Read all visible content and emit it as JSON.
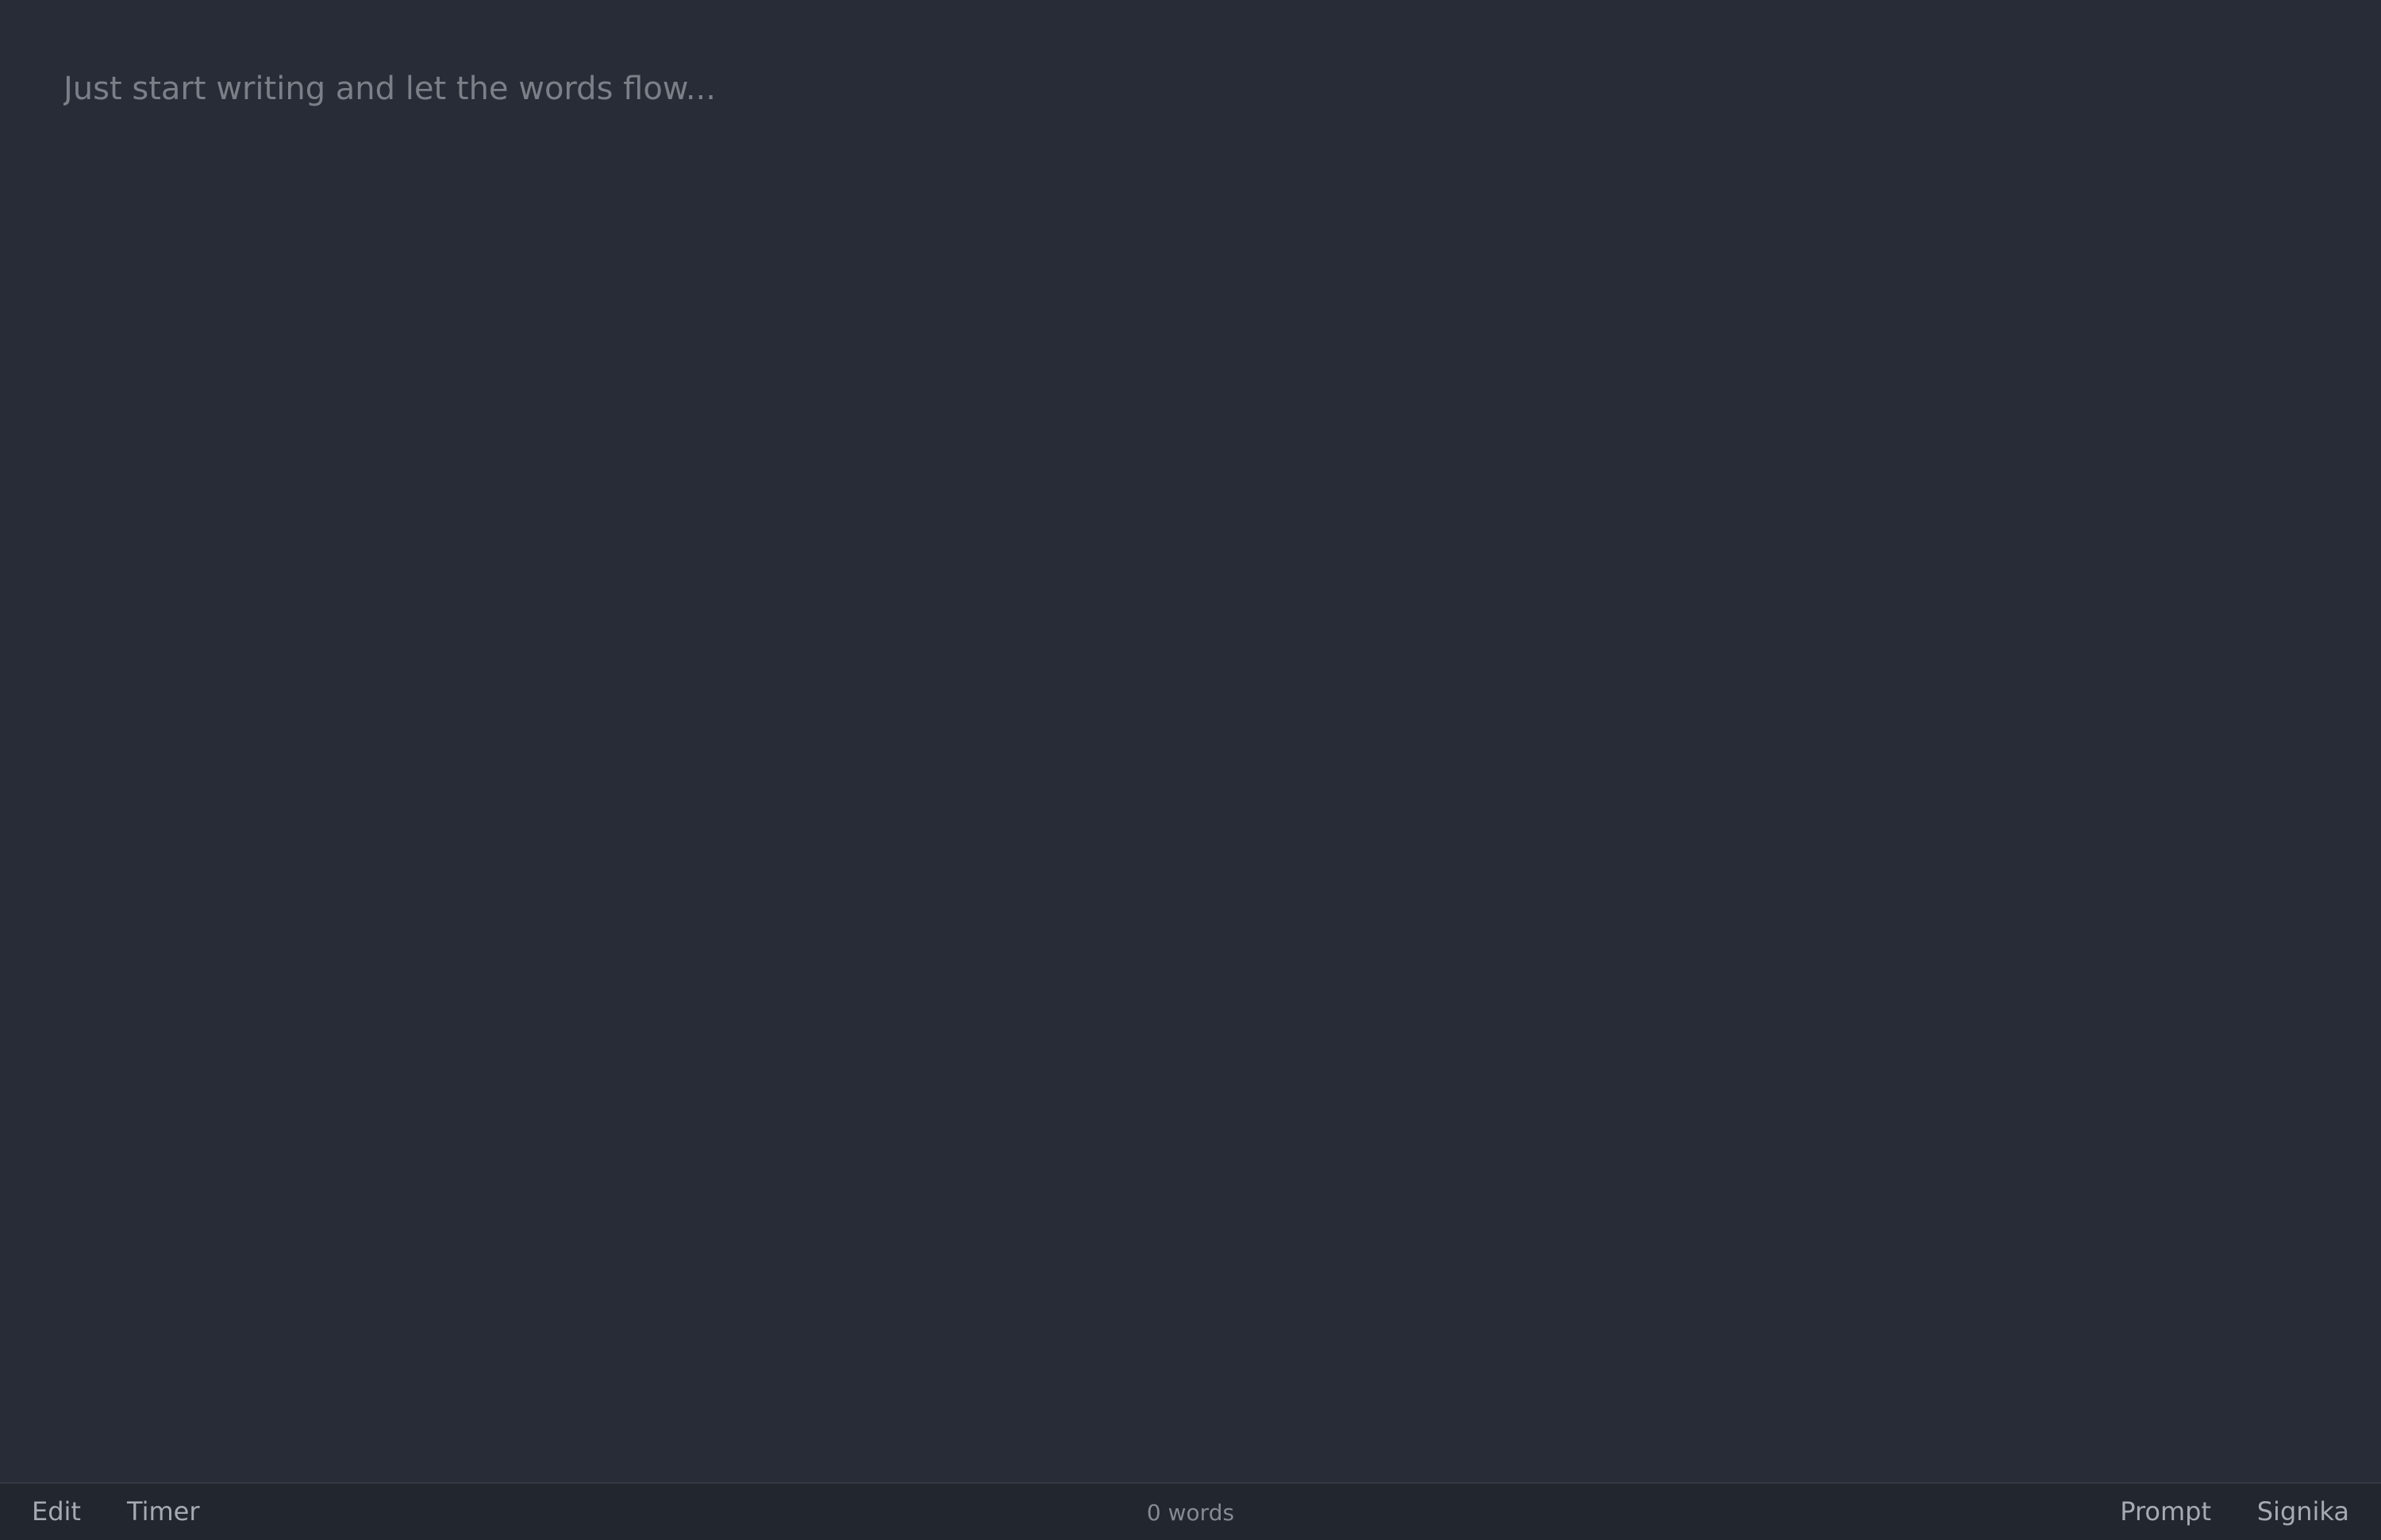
{
  "editor": {
    "placeholder": "Just start writing and let the words flow...",
    "value": ""
  },
  "bottom_bar": {
    "edit_label": "Edit",
    "timer_label": "Timer",
    "word_count": "0 words",
    "prompt_label": "Prompt",
    "font_label": "Signika"
  },
  "colors": {
    "background": "#282c36",
    "bottom_bar_background": "#22262e",
    "placeholder_text": "#7b7f88",
    "menu_text": "#a6aab2"
  }
}
